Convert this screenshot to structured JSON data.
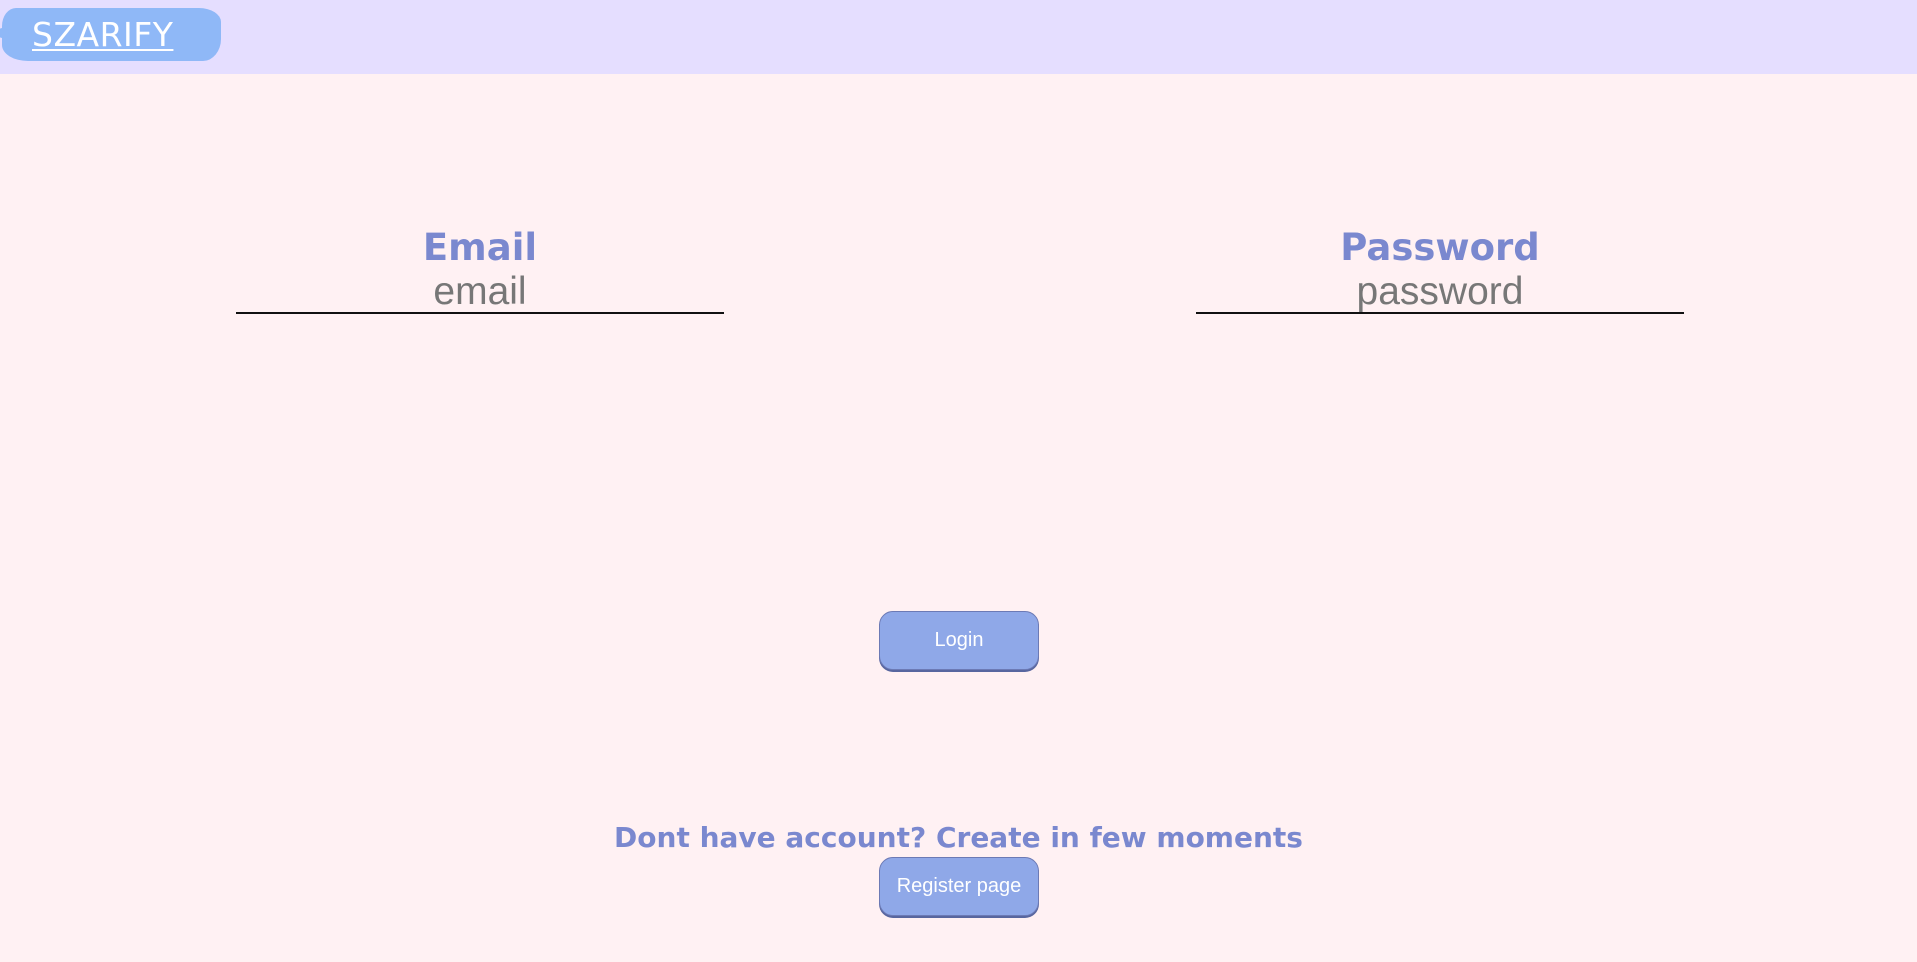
{
  "navbar": {
    "logo_text": "SZARIFY",
    "background_color": "#e5deff",
    "logo_color": "#8fb8f7"
  },
  "login_form": {
    "email": {
      "label": "Email",
      "placeholder": "email"
    },
    "password": {
      "label": "Password",
      "placeholder": "password"
    },
    "login_button_label": "Login"
  },
  "register": {
    "prompt_text": "Dont have account? Create in few moments",
    "button_label": "Register page"
  },
  "colors": {
    "page_background": "#fff1f3",
    "accent_text": "#7a88cf",
    "button_background": "#8fa8e8"
  }
}
